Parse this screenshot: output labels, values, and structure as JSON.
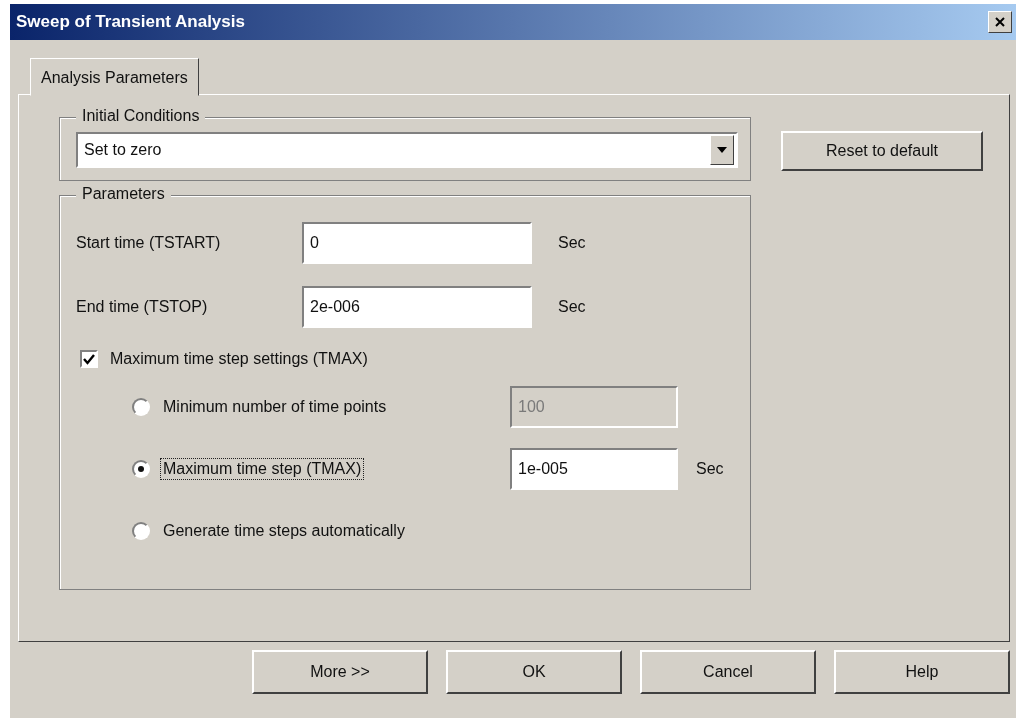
{
  "window": {
    "title": "Sweep of Transient Analysis"
  },
  "tabs": [
    {
      "label": "Analysis Parameters",
      "selected": true
    }
  ],
  "initial_conditions": {
    "legend": "Initial Conditions",
    "value": "Set to zero"
  },
  "reset_button": "Reset to default",
  "parameters": {
    "legend": "Parameters",
    "fields": [
      {
        "label": "Start time (TSTART)",
        "value": "0",
        "unit": "Sec"
      },
      {
        "label": "End time (TSTOP)",
        "value": "2e-006",
        "unit": "Sec"
      }
    ],
    "tmax": {
      "label": "Maximum time step settings (TMAX)",
      "checked": true,
      "options": [
        {
          "label": "Minimum number of time points",
          "selected": false,
          "focused": false,
          "value": "100",
          "disabled": true
        },
        {
          "label": "Maximum time step (TMAX)",
          "selected": true,
          "focused": true,
          "value": "1e-005",
          "unit": "Sec",
          "disabled": false
        },
        {
          "label": "Generate time steps automatically",
          "selected": false,
          "focused": false
        }
      ]
    }
  },
  "buttons": [
    "More >>",
    "OK",
    "Cancel",
    "Help"
  ]
}
